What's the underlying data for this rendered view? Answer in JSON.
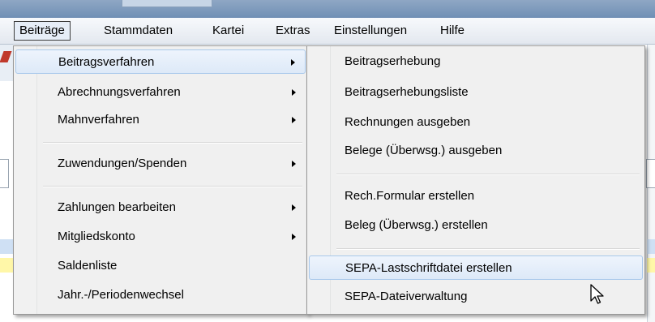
{
  "menubar": {
    "items": [
      "Beiträge",
      "Stammdaten",
      "Kartei",
      "Extras",
      "Einstellungen",
      "Hilfe"
    ],
    "active_index": 0
  },
  "main_menu": {
    "items": [
      {
        "label": "Beitragsverfahren",
        "submenu": true,
        "highlighted": true
      },
      {
        "label": "Abrechnungsverfahren",
        "submenu": true
      },
      {
        "label": "Mahnverfahren",
        "submenu": true
      },
      {
        "label": "Zuwendungen/Spenden",
        "submenu": true
      },
      {
        "label": "Zahlungen bearbeiten",
        "submenu": true
      },
      {
        "label": "Mitgliedskonto",
        "submenu": true
      },
      {
        "label": "Saldenliste",
        "submenu": false
      },
      {
        "label": "Jahr.-/Periodenwechsel",
        "submenu": false
      }
    ]
  },
  "sub_menu": {
    "items": [
      {
        "label": "Beitragserhebung"
      },
      {
        "label": "Beitragserhebungsliste"
      },
      {
        "label": "Rechnungen ausgeben"
      },
      {
        "label": "Belege (Überwsg.) ausgeben"
      },
      {
        "label": "Rech.Formular erstellen"
      },
      {
        "label": "Beleg (Überwsg.) erstellen"
      },
      {
        "label": "SEPA-Lastschriftdatei erstellen",
        "highlighted": true
      },
      {
        "label": "SEPA-Dateiverwaltung"
      }
    ]
  },
  "colors": {
    "menu_bg": "#f0f0f0",
    "highlight_border": "#a8c8eb",
    "highlight_bg": "#dde9f8",
    "row_blue": "#cfe0f4",
    "row_yellow": "#fff7a8"
  }
}
